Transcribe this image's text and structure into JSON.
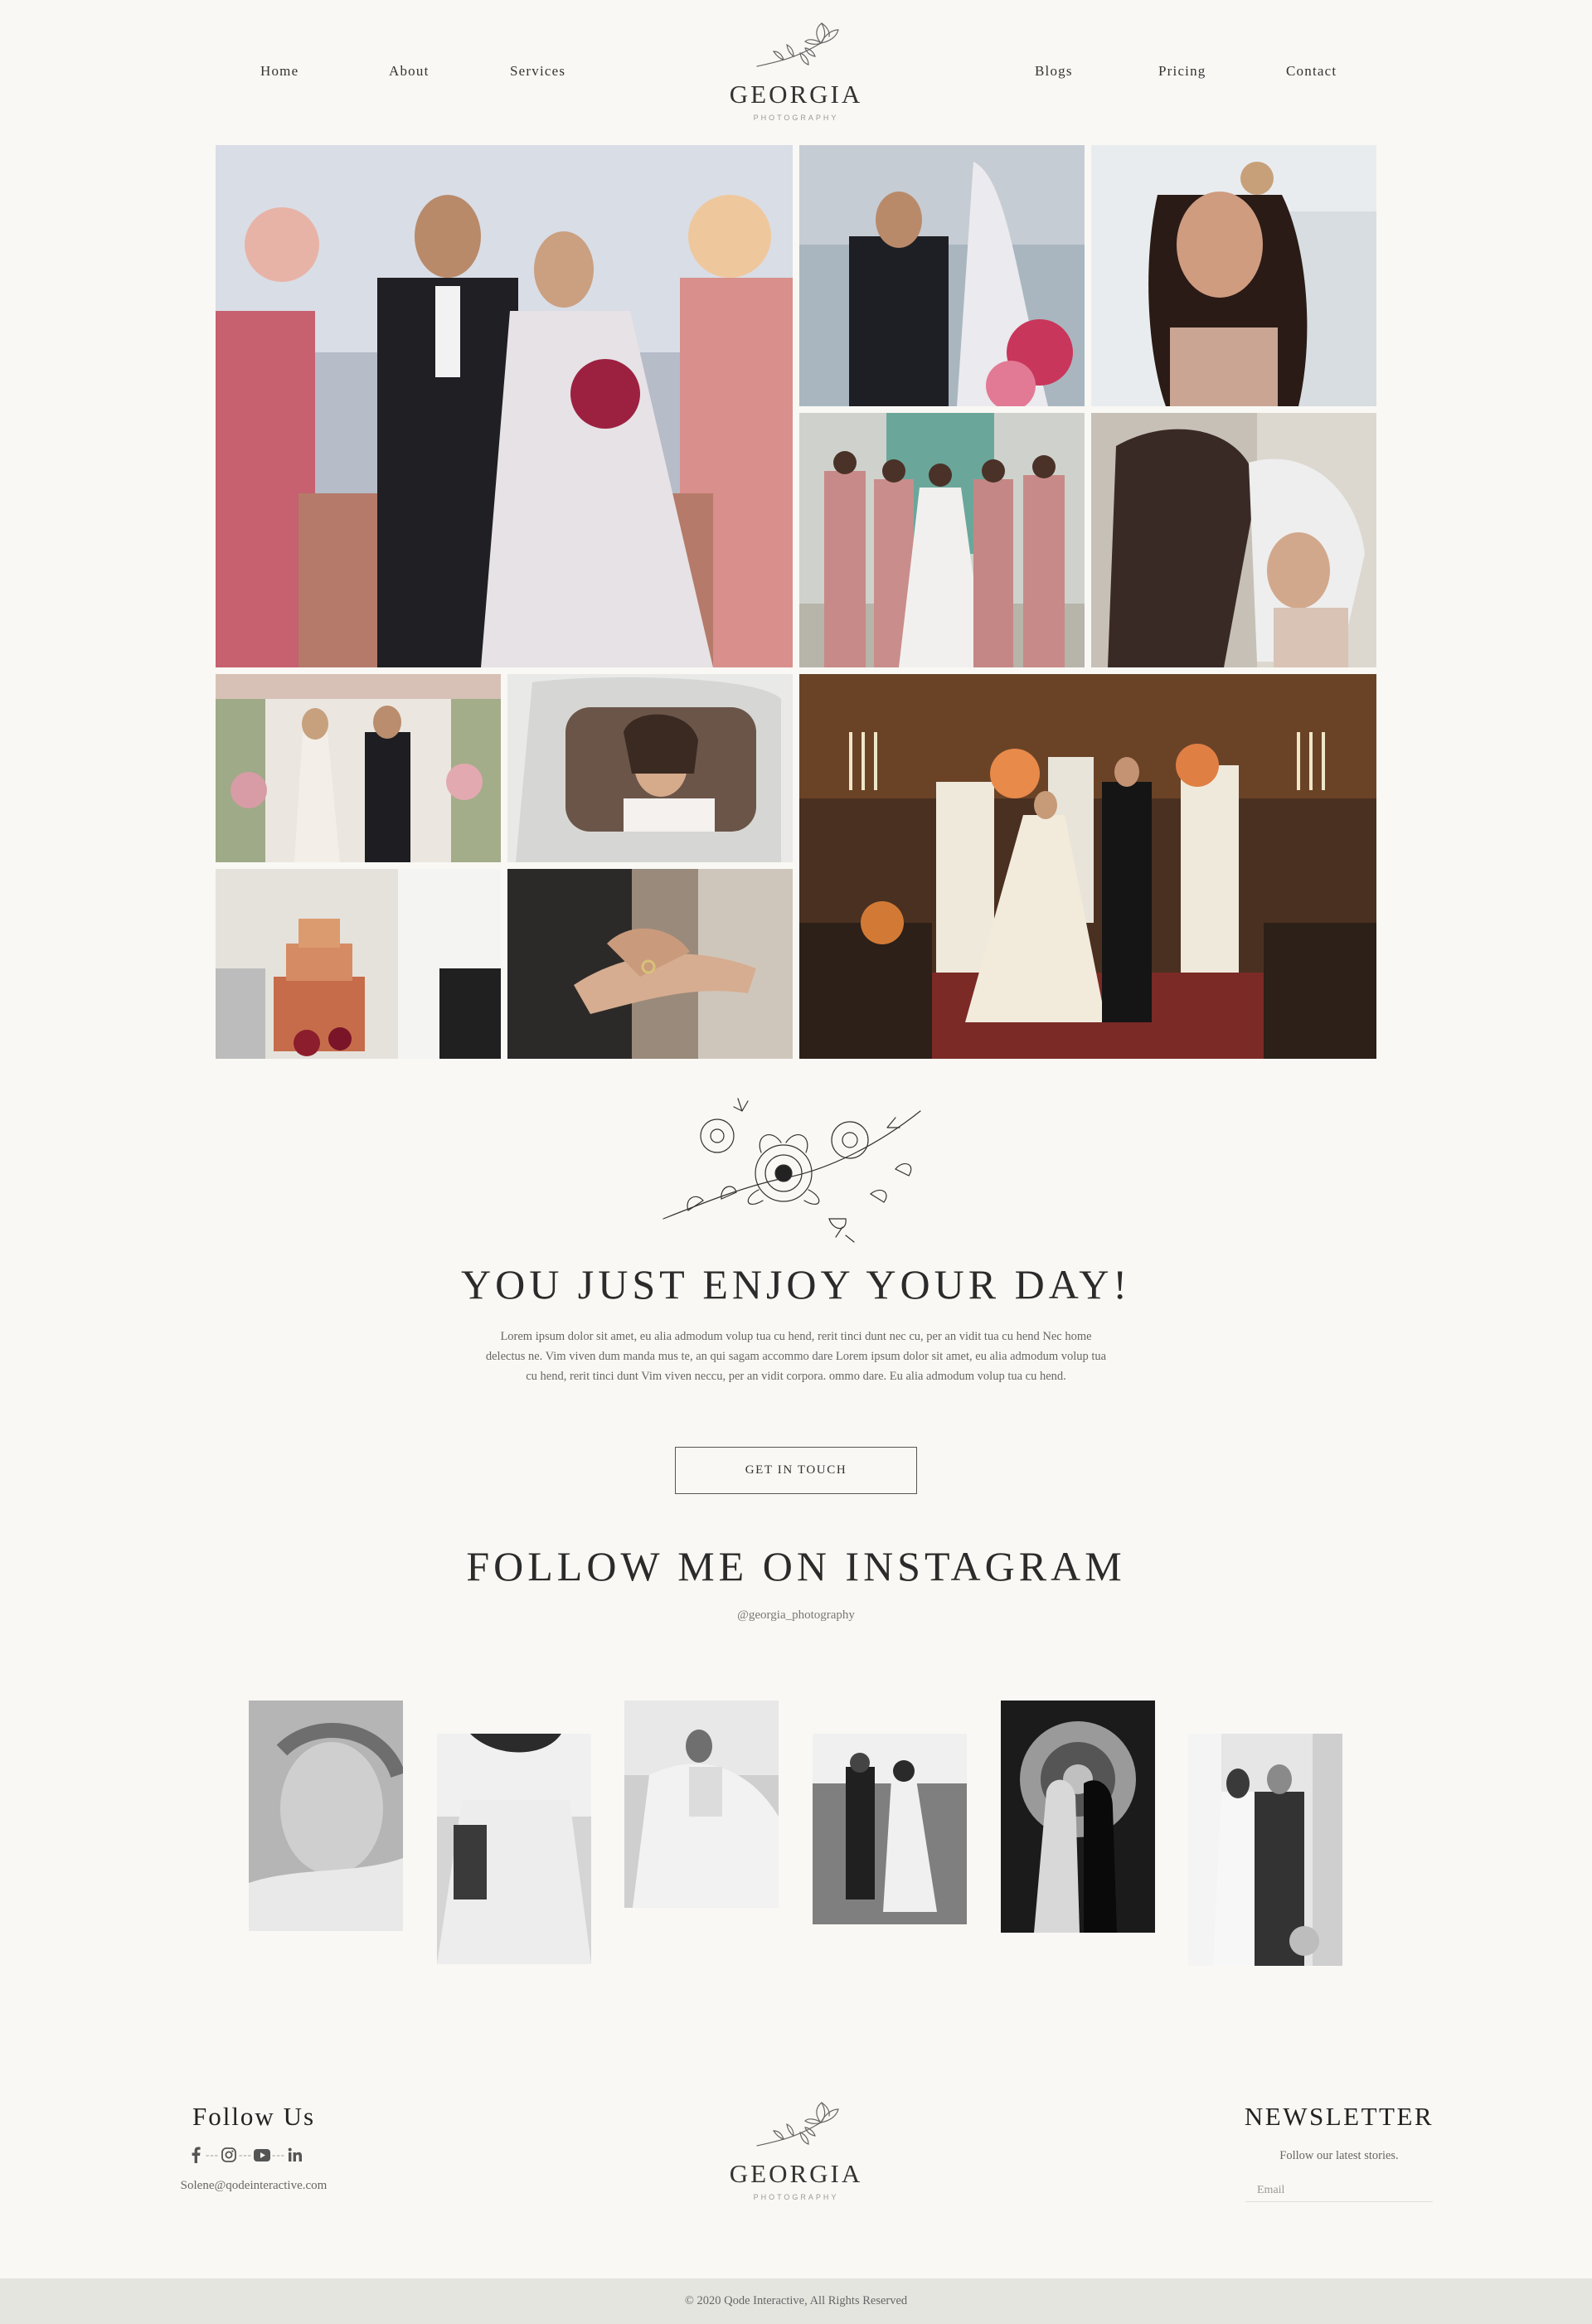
{
  "header": {
    "nav_left": [
      "Home",
      "About",
      "Services"
    ],
    "nav_right": [
      "Blogs",
      "Pricing",
      "Contact"
    ],
    "logo_name": "GEORGIA",
    "logo_sub": "PHOTOGRAPHY"
  },
  "gallery": {
    "photos": [
      "bride-and-groom-walking-aisle",
      "groom-with-bride-in-veil",
      "smiling-bride-portrait",
      "bridesmaids-with-bride",
      "groom-lifting-veil",
      "vows-under-floral-arch",
      "bride-in-car",
      "cake-cutting",
      "ring-exchange",
      "church-ceremony"
    ]
  },
  "intro": {
    "title": "YOU JUST ENJOY YOUR DAY!",
    "text": "Lorem ipsum dolor sit amet, eu alia admodum volup tua cu hend, rerit tinci dunt nec cu, per an vidit tua cu hend Nec home delectus ne. Vim viven dum manda mus te, an qui sagam accommo dare Lorem ipsum dolor sit amet, eu alia admodum volup tua cu hend, rerit tinci dunt Vim viven neccu, per an vidit corpora. ommo dare. Eu alia admodum volup tua cu hend.",
    "button_label": "GET IN TOUCH"
  },
  "instagram": {
    "title": "FOLLOW ME ON INSTAGRAM",
    "handle": "@georgia_photography"
  },
  "footer": {
    "follow_title": "Follow Us",
    "social_icons": [
      "facebook-icon",
      "instagram-icon",
      "youtube-icon",
      "linkedin-icon"
    ],
    "email": "Solene@qodeinteractive.com",
    "logo_name": "GEORGIA",
    "logo_sub": "PHOTOGRAPHY",
    "newsletter_title": "NEWSLETTER",
    "newsletter_sub": "Follow our latest stories.",
    "email_placeholder": "Email",
    "copyright": "© 2020 Qode Interactive, All Rights Reserved"
  },
  "colors": {
    "background": "#f9f8f4",
    "text": "#2b2b2b",
    "muted": "#666666",
    "copyright_bar": "#e5e5e0"
  }
}
